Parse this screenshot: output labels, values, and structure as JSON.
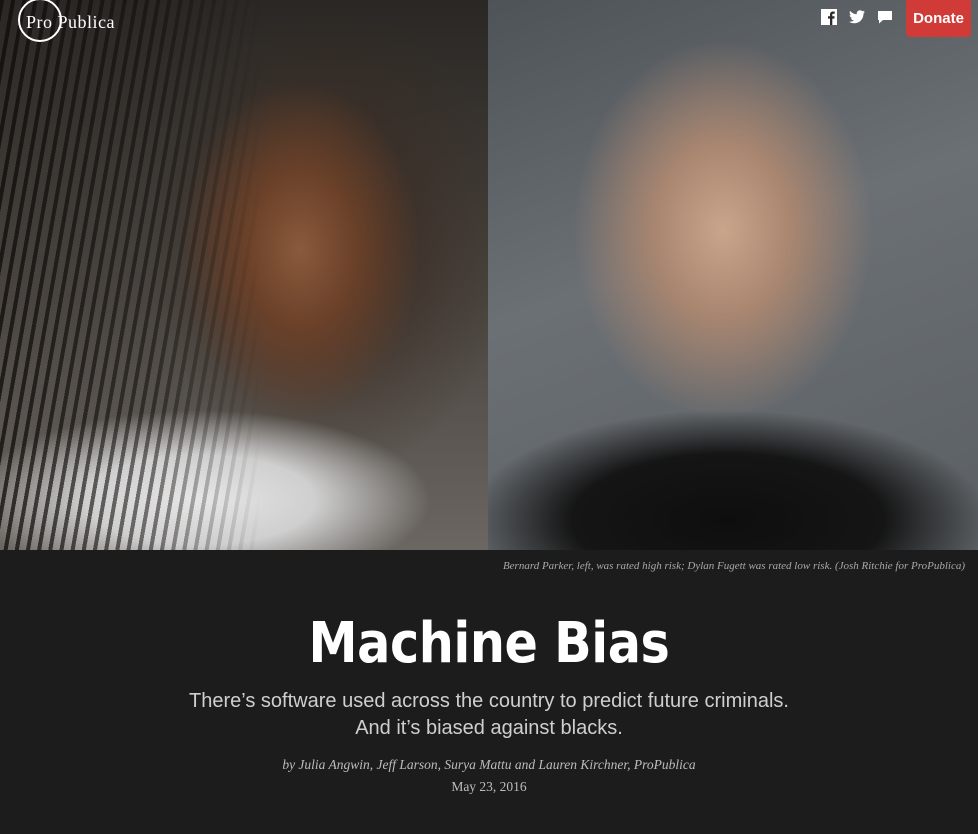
{
  "header": {
    "logo_text": "Pro Publica",
    "social_icons": [
      "facebook-icon",
      "twitter-icon",
      "comment-icon"
    ],
    "donate_label": "Donate",
    "donate_color": "#d03b37"
  },
  "hero": {
    "caption": "Bernard Parker, left, was rated high risk; Dylan Fugett was rated low risk. (Josh Ritchie for ProPublica)"
  },
  "article": {
    "title": "Machine Bias",
    "dek": "There’s software used across the country to predict future criminals. And it’s biased against blacks.",
    "byline": "by Julia Angwin, Jeff Larson, Surya Mattu and Lauren Kirchner, ProPublica",
    "date": "May 23, 2016"
  }
}
